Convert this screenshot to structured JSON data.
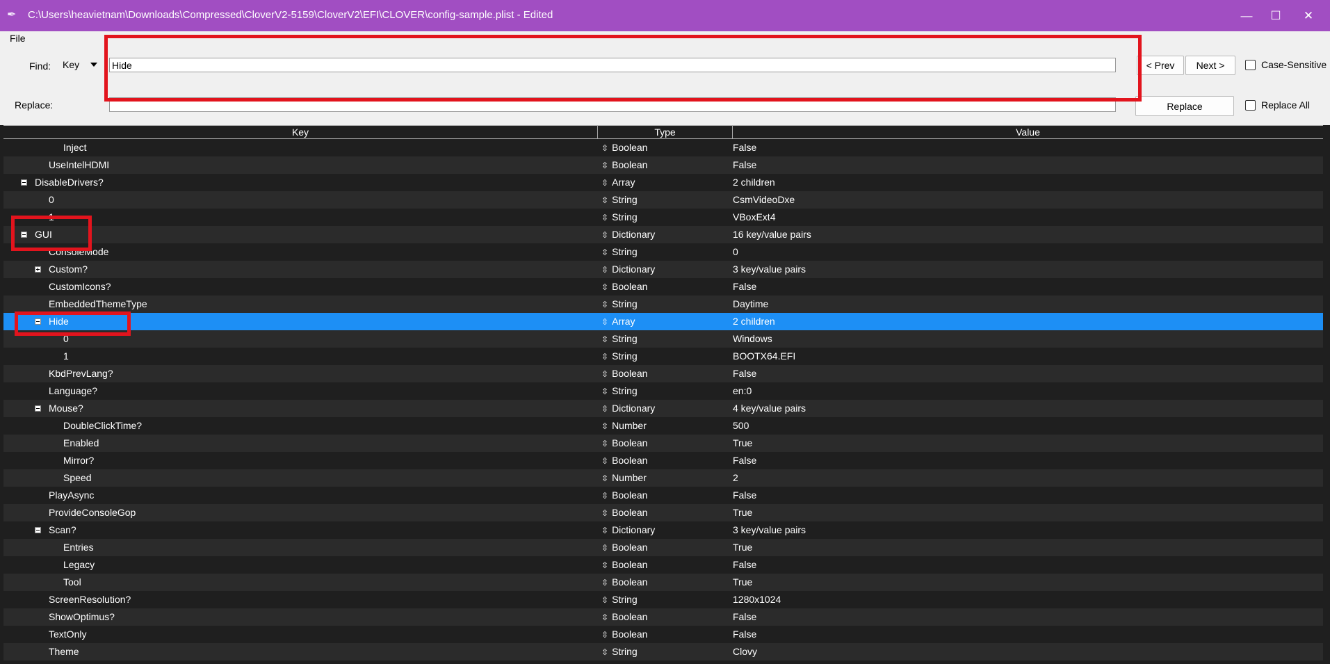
{
  "window": {
    "title": "C:\\Users\\heavietnam\\Downloads\\Compressed\\CloverV2-5159\\CloverV2\\EFI\\CLOVER\\config-sample.plist - Edited",
    "minimize_glyph": "—",
    "maximize_glyph": "☐",
    "close_glyph": "✕",
    "app_icon": "feather-icon"
  },
  "menu": {
    "file": "File"
  },
  "find": {
    "label": "Find:",
    "mode": "Key",
    "value": "Hide",
    "prev": "< Prev",
    "next": "Next >",
    "case_sensitive": "Case-Sensitive"
  },
  "replace": {
    "label": "Replace:",
    "value": "",
    "button": "Replace",
    "replace_all": "Replace All"
  },
  "columns": {
    "key": "Key",
    "type": "Type",
    "value": "Value"
  },
  "type_glyph": "⇳",
  "rows": [
    {
      "key": "Inject",
      "depth": 3,
      "toggle": null,
      "type": "Boolean",
      "value": "False"
    },
    {
      "key": "UseIntelHDMI",
      "depth": 2,
      "toggle": null,
      "type": "Boolean",
      "value": "False"
    },
    {
      "key": "DisableDrivers?",
      "depth": 1,
      "toggle": "minus",
      "type": "Array",
      "value": "2 children"
    },
    {
      "key": "0",
      "depth": 2,
      "toggle": null,
      "type": "String",
      "value": "CsmVideoDxe"
    },
    {
      "key": "1",
      "depth": 2,
      "toggle": null,
      "type": "String",
      "value": "VBoxExt4"
    },
    {
      "key": "GUI",
      "depth": 1,
      "toggle": "minus",
      "type": "Dictionary",
      "value": "16 key/value pairs"
    },
    {
      "key": "ConsoleMode",
      "depth": 2,
      "toggle": null,
      "type": "String",
      "value": "0"
    },
    {
      "key": "Custom?",
      "depth": 2,
      "toggle": "plus",
      "type": "Dictionary",
      "value": "3 key/value pairs"
    },
    {
      "key": "CustomIcons?",
      "depth": 2,
      "toggle": null,
      "type": "Boolean",
      "value": "False"
    },
    {
      "key": "EmbeddedThemeType",
      "depth": 2,
      "toggle": null,
      "type": "String",
      "value": "Daytime"
    },
    {
      "key": "Hide",
      "depth": 2,
      "toggle": "minus",
      "type": "Array",
      "value": "2 children",
      "selected": true
    },
    {
      "key": "0",
      "depth": 3,
      "toggle": null,
      "type": "String",
      "value": "Windows"
    },
    {
      "key": "1",
      "depth": 3,
      "toggle": null,
      "type": "String",
      "value": "BOOTX64.EFI"
    },
    {
      "key": "KbdPrevLang?",
      "depth": 2,
      "toggle": null,
      "type": "Boolean",
      "value": "False"
    },
    {
      "key": "Language?",
      "depth": 2,
      "toggle": null,
      "type": "String",
      "value": "en:0"
    },
    {
      "key": "Mouse?",
      "depth": 2,
      "toggle": "minus",
      "type": "Dictionary",
      "value": "4 key/value pairs"
    },
    {
      "key": "DoubleClickTime?",
      "depth": 3,
      "toggle": null,
      "type": "Number",
      "value": "500"
    },
    {
      "key": "Enabled",
      "depth": 3,
      "toggle": null,
      "type": "Boolean",
      "value": "True"
    },
    {
      "key": "Mirror?",
      "depth": 3,
      "toggle": null,
      "type": "Boolean",
      "value": "False"
    },
    {
      "key": "Speed",
      "depth": 3,
      "toggle": null,
      "type": "Number",
      "value": "2"
    },
    {
      "key": "PlayAsync",
      "depth": 2,
      "toggle": null,
      "type": "Boolean",
      "value": "False"
    },
    {
      "key": "ProvideConsoleGop",
      "depth": 2,
      "toggle": null,
      "type": "Boolean",
      "value": "True"
    },
    {
      "key": "Scan?",
      "depth": 2,
      "toggle": "minus",
      "type": "Dictionary",
      "value": "3 key/value pairs"
    },
    {
      "key": "Entries",
      "depth": 3,
      "toggle": null,
      "type": "Boolean",
      "value": "True"
    },
    {
      "key": "Legacy",
      "depth": 3,
      "toggle": null,
      "type": "Boolean",
      "value": "False"
    },
    {
      "key": "Tool",
      "depth": 3,
      "toggle": null,
      "type": "Boolean",
      "value": "True"
    },
    {
      "key": "ScreenResolution?",
      "depth": 2,
      "toggle": null,
      "type": "String",
      "value": "1280x1024"
    },
    {
      "key": "ShowOptimus?",
      "depth": 2,
      "toggle": null,
      "type": "Boolean",
      "value": "False"
    },
    {
      "key": "TextOnly",
      "depth": 2,
      "toggle": null,
      "type": "Boolean",
      "value": "False"
    },
    {
      "key": "Theme",
      "depth": 2,
      "toggle": null,
      "type": "String",
      "value": "Clovy"
    }
  ],
  "colors": {
    "titlebar": "#a14ec2",
    "selection": "#1d8ff5",
    "highlight_box": "#e2141d",
    "table_bg": "#1f1f1f",
    "table_alt": "#2b2b2b"
  }
}
